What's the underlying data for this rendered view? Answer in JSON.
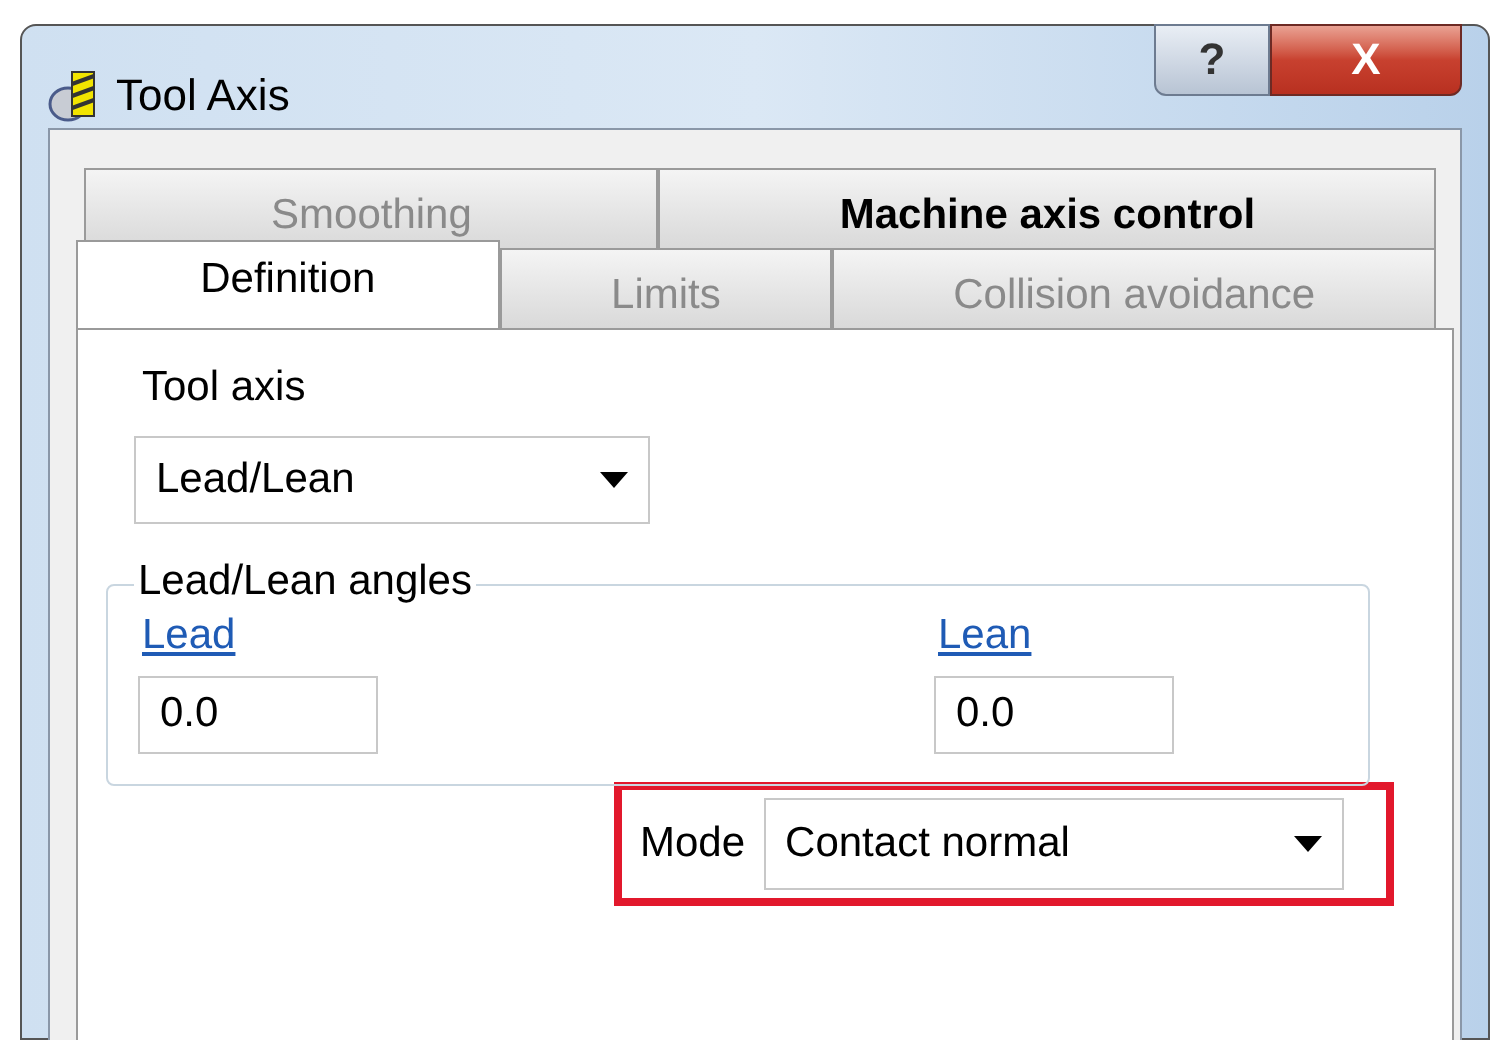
{
  "window": {
    "title": "Tool Axis",
    "buttons": [
      "?",
      "X"
    ]
  },
  "tab_rows": [
    [
      {
        "label": "Smoothing",
        "selected": false,
        "disabled": true
      },
      {
        "label": "Machine axis control",
        "selected": false,
        "disabled": false
      }
    ],
    [
      {
        "label": "Definition",
        "selected": true,
        "disabled": false
      },
      {
        "label": "Limits",
        "selected": false,
        "disabled": true
      },
      {
        "label": "Collision avoidance",
        "selected": false,
        "disabled": true
      }
    ]
  ],
  "tool_axis": {
    "label": "Tool axis",
    "value": "Lead/Lean"
  },
  "angles": {
    "title": "Lead/Lean angles",
    "fields": [
      {
        "label": "Lead",
        "value": "0.0"
      },
      {
        "label": "Lean",
        "value": "0.0"
      }
    ]
  },
  "mode": {
    "label": "Mode",
    "value": "Contact normal",
    "highlighted": true
  }
}
